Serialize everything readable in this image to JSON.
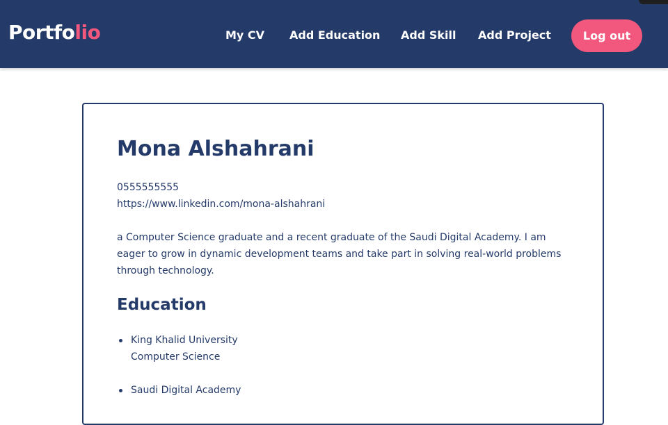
{
  "header": {
    "brand_part1": "Portfo",
    "brand_part2": "lio",
    "nav": [
      "My CV",
      "Add Education",
      "Add Skill",
      "Add Project"
    ],
    "logout_label": "Log out"
  },
  "profile": {
    "name": "Mona Alshahrani",
    "phone": "0555555555",
    "linkedin": "https://www.linkedin.com/mona-alshahrani",
    "bio": "a Computer Science graduate and a recent graduate of the Saudi Digital Academy. I am eager to grow in dynamic development teams and take part in solving real-world problems through technology."
  },
  "education": {
    "title": "Education",
    "items": [
      {
        "institution": "King Khalid University",
        "field": "Computer Science"
      },
      {
        "institution": "Saudi Digital Academy",
        "field": ""
      }
    ]
  },
  "colors": {
    "navy": "#243a69",
    "accent": "#f2577e",
    "background": "#ffffff"
  }
}
